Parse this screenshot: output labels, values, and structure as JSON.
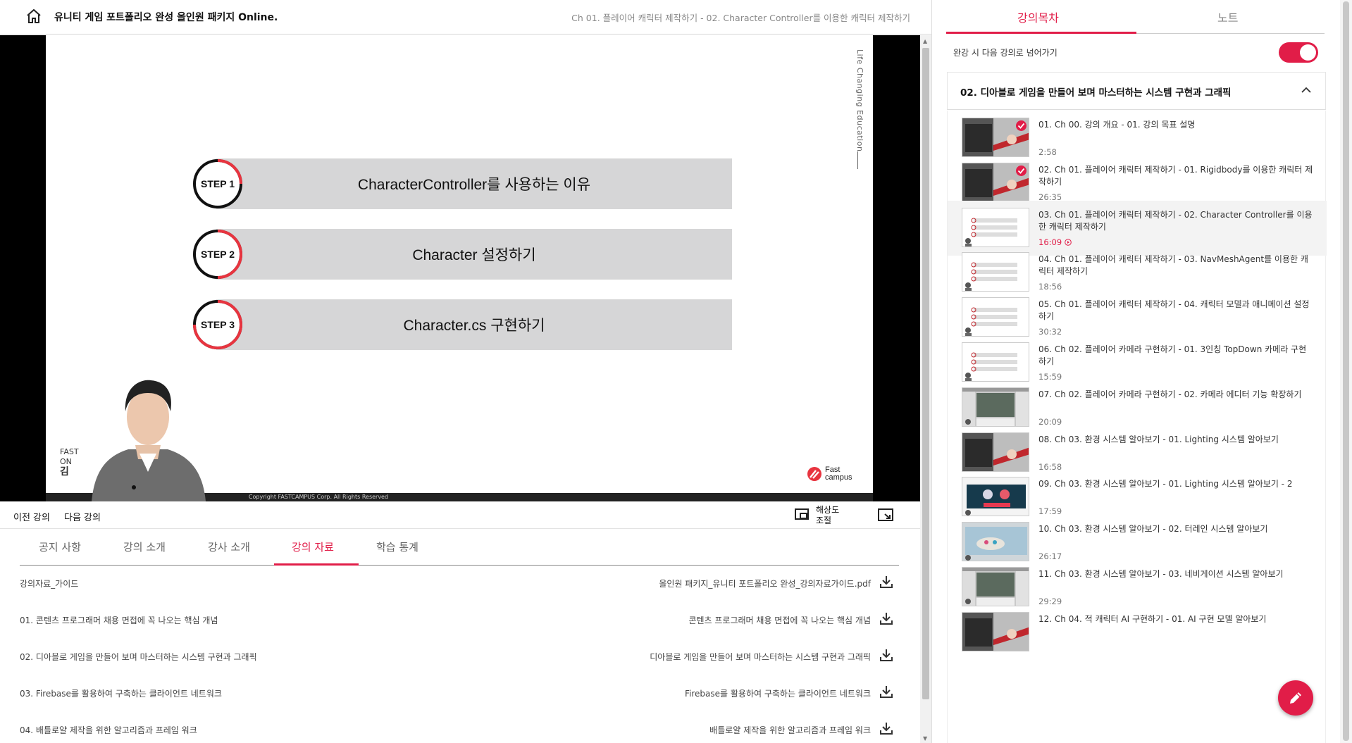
{
  "header": {
    "course_title": "유니티 게임 포트폴리오 완성 올인원 패키지 Online.",
    "lecture_path": "Ch 01. 플레이어 캐릭터 제작하기 - 02. Character Controller를 이용한 캐릭터 제작하기"
  },
  "slide": {
    "vertical_text": "Life Changing Education",
    "steps": [
      {
        "label": "STEP 1",
        "text": "CharacterController를 사용하는 이유"
      },
      {
        "label": "STEP 2",
        "text": "Character 설정하기"
      },
      {
        "label": "STEP 3",
        "text": "Character.cs 구현하기"
      }
    ],
    "footer_lines": [
      "FAST",
      "ON",
      "김"
    ],
    "logo_line1": "Fast",
    "logo_line2": "campus",
    "copyright": "Copyright FASTCAMPUS Corp. All Rights Reserved"
  },
  "player": {
    "progress_percent": 1.8,
    "prev_label": "이전 강의",
    "next_label": "다음 강의",
    "resolution_label_1": "해상도",
    "resolution_label_2": "조절"
  },
  "tabs": [
    {
      "label": "공지 사항"
    },
    {
      "label": "강의 소개"
    },
    {
      "label": "강사 소개"
    },
    {
      "label": "강의 자료"
    },
    {
      "label": "학습 통계"
    }
  ],
  "active_tab": "강의 자료",
  "materials": [
    {
      "name": "강의자료_가이드",
      "file": "올인원 패키지_유니티 포트폴리오 완성_강의자료가이드.pdf"
    },
    {
      "name": "01. 콘텐츠 프로그래머 채용 면접에 꼭 나오는 핵심 개념",
      "file": "콘텐츠 프로그래머 채용 면접에 꼭 나오는 핵심 개념"
    },
    {
      "name": "02. 디아블로 게임을 만들어 보며 마스터하는 시스템 구현과 그래픽",
      "file": "디아블로 게임을 만들어 보며 마스터하는 시스템 구현과 그래픽"
    },
    {
      "name": "03. Firebase를 활용하여 구축하는 클라이언트 네트워크",
      "file": "Firebase를 활용하여 구축하는 클라이언트 네트워크"
    },
    {
      "name": "04. 배틀로얄 제작을 위한 알고리즘과 프레임 워크",
      "file": "배틀로얄 제작을 위한 알고리즘과 프레임 워크"
    }
  ],
  "sidebar": {
    "tab_toc": "강의목차",
    "tab_notes": "노트",
    "auto_next_label": "완강 시 다음 강의로 넘어가기",
    "auto_next_on": true,
    "section_title": "02. 디아블로 게임을 만들어 보며 마스터하는 시스템 구현과 그래픽",
    "lectures": [
      {
        "title": "01. Ch 00. 강의 개요 - 01. 강의 목표 설명",
        "duration": "2:58",
        "thumb": "intro",
        "done": true
      },
      {
        "title": "02. Ch 01. 플레이어 캐릭터 제작하기 - 01. Rigidbody를 이용한 캐릭터 제작하기",
        "duration": "26:35",
        "thumb": "intro",
        "done": true
      },
      {
        "title": "03. Ch 01. 플레이어 캐릭터 제작하기 - 02. Character Controller를 이용한 캐릭터 제작하기",
        "duration": "16:09",
        "thumb": "slide",
        "current": true
      },
      {
        "title": "04. Ch 01. 플레이어 캐릭터 제작하기 - 03. NavMeshAgent를 이용한 캐릭터 제작하기",
        "duration": "18:56",
        "thumb": "slide"
      },
      {
        "title": "05. Ch 01. 플레이어 캐릭터 제작하기 - 04. 캐릭터 모델과 애니메이션 설정하기",
        "duration": "30:32",
        "thumb": "slide"
      },
      {
        "title": "06. Ch 02. 플레이어 카메라 구현하기 - 01. 3인칭 TopDown 카메라 구현하기",
        "duration": "15:59",
        "thumb": "slide"
      },
      {
        "title": "07. Ch 02. 플레이어 카메라 구현하기 - 02. 카메라 에디터 기능 확장하기",
        "duration": "20:09",
        "thumb": "editor"
      },
      {
        "title": "08. Ch 03. 환경 시스템 알아보기 - 01. Lighting 시스템 알아보기",
        "duration": "16:58",
        "thumb": "intro"
      },
      {
        "title": "09. Ch 03. 환경 시스템 알아보기 - 01. Lighting 시스템 알아보기 - 2",
        "duration": "17:59",
        "thumb": "probes"
      },
      {
        "title": "10. Ch 03. 환경 시스템 알아보기 - 02. 터레인 시스템 알아보기",
        "duration": "26:17",
        "thumb": "terrain"
      },
      {
        "title": "11. Ch 03. 환경 시스템 알아보기 - 03. 네비게이션 시스템 알아보기",
        "duration": "29:29",
        "thumb": "editor"
      },
      {
        "title": "12. Ch 04. 적 캐릭터 AI 구현하기 - 01. AI 구현 모델 알아보기",
        "duration": "",
        "thumb": "intro"
      }
    ]
  },
  "colors": {
    "accent": "#e11d48",
    "player_bg": "#000000",
    "step_bar": "#d6d6d7"
  }
}
